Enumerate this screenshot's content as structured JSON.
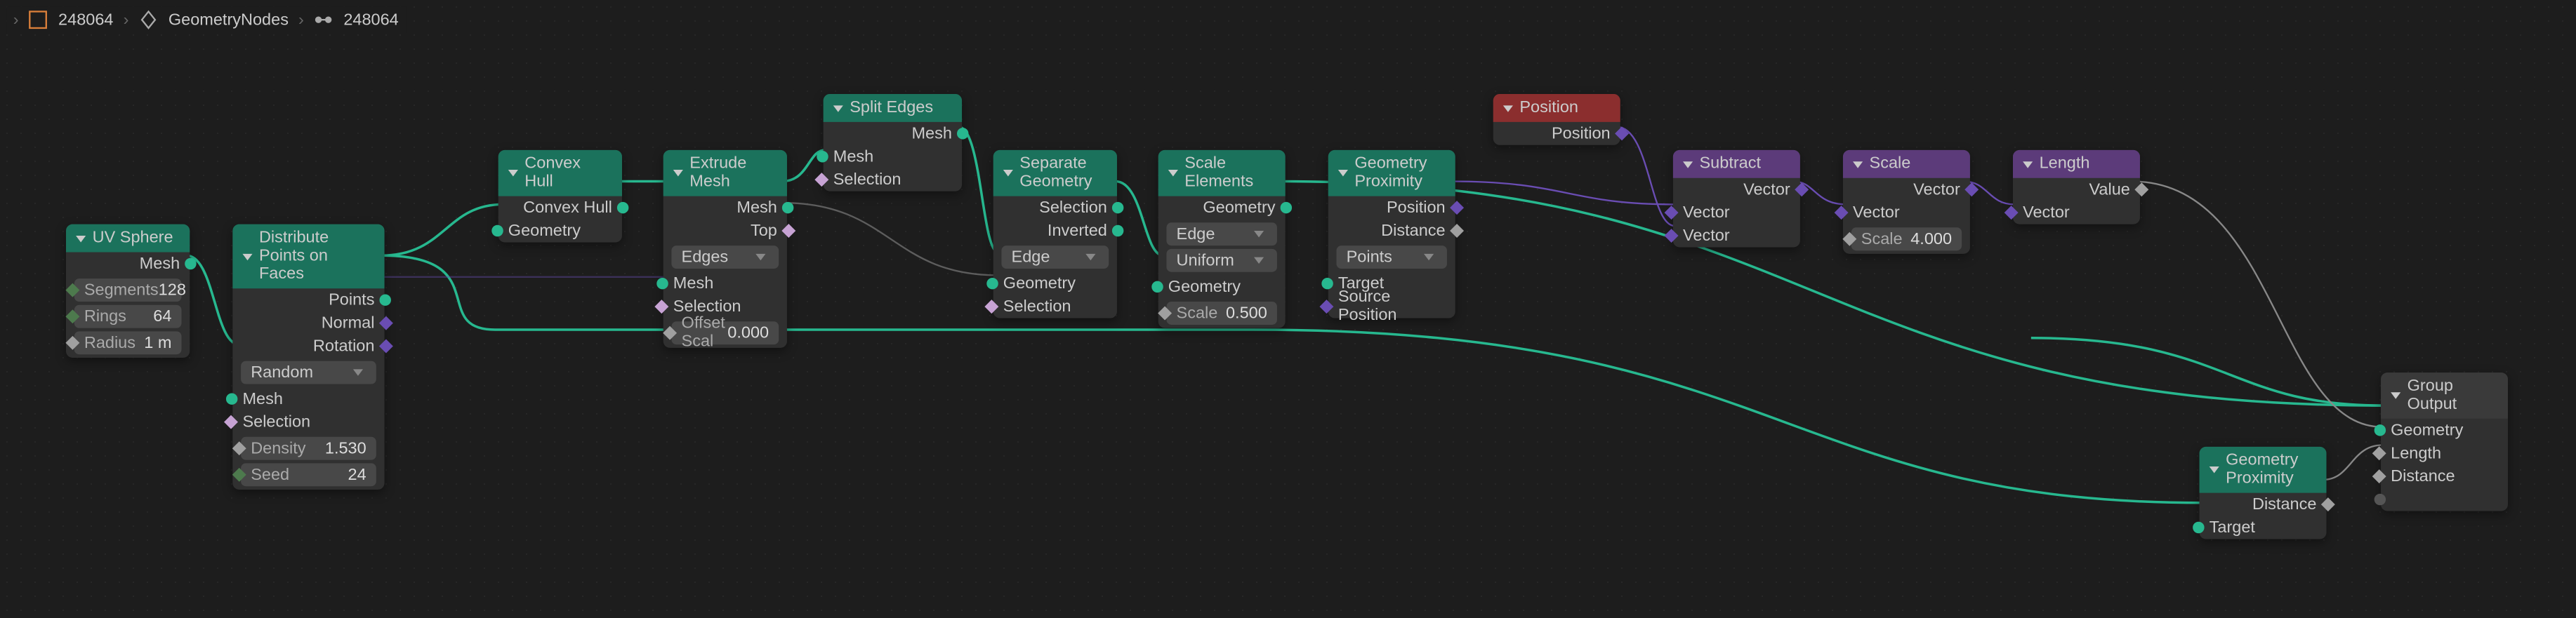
{
  "breadcrumb": {
    "obj": "248064",
    "mod": "GeometryNodes",
    "ng": "248064"
  },
  "nodes": {
    "uvsphere": {
      "title": "UV Sphere",
      "outputs": {
        "mesh": "Mesh"
      },
      "segments_l": "Segments",
      "segments_v": "128",
      "rings_l": "Rings",
      "rings_v": "64",
      "radius_l": "Radius",
      "radius_v": "1 m"
    },
    "distrib": {
      "title": "Distribute Points on Faces",
      "outputs": {
        "points": "Points",
        "normal": "Normal",
        "rotation": "Rotation"
      },
      "mode": "Random",
      "mesh": "Mesh",
      "selection": "Selection",
      "density_l": "Density",
      "density_v": "1.530",
      "seed_l": "Seed",
      "seed_v": "24"
    },
    "convex": {
      "title": "Convex Hull",
      "out": "Convex Hull",
      "in": "Geometry"
    },
    "extrude": {
      "title": "Extrude Mesh",
      "outs": {
        "mesh": "Mesh",
        "top": "Top"
      },
      "mode": "Edges",
      "mesh": "Mesh",
      "selection": "Selection",
      "offscale_l": "Offset Scal",
      "offscale_v": "0.000"
    },
    "split": {
      "title": "Split Edges",
      "out": "Mesh",
      "mesh": "Mesh",
      "selection": "Selection"
    },
    "separate": {
      "title": "Separate Geometry",
      "outs": {
        "selection": "Selection",
        "inverted": "Inverted"
      },
      "mode": "Edge",
      "geometry": "Geometry",
      "selection": "Selection"
    },
    "scaleel": {
      "title": "Scale Elements",
      "out": "Geometry",
      "mode_d": "Edge",
      "mode_u": "Uniform",
      "geometry": "Geometry",
      "scale_l": "Scale",
      "scale_v": "0.500"
    },
    "geoprox1": {
      "title": "Geometry Proximity",
      "outs": {
        "position": "Position",
        "distance": "Distance"
      },
      "mode": "Points",
      "target": "Target",
      "srcpos": "Source Position"
    },
    "position": {
      "title": "Position",
      "out": "Position"
    },
    "subtract": {
      "title": "Subtract",
      "out": "Vector",
      "in1": "Vector",
      "in2": "Vector"
    },
    "scalevec": {
      "title": "Scale",
      "out": "Vector",
      "in": "Vector",
      "scale_l": "Scale",
      "scale_v": "4.000"
    },
    "length": {
      "title": "Length",
      "out": "Value",
      "in": "Vector"
    },
    "geoprox2": {
      "title": "Geometry Proximity",
      "out": "Distance",
      "target": "Target"
    },
    "groupout": {
      "title": "Group Output",
      "geometry": "Geometry",
      "length": "Length",
      "distance": "Distance"
    }
  }
}
